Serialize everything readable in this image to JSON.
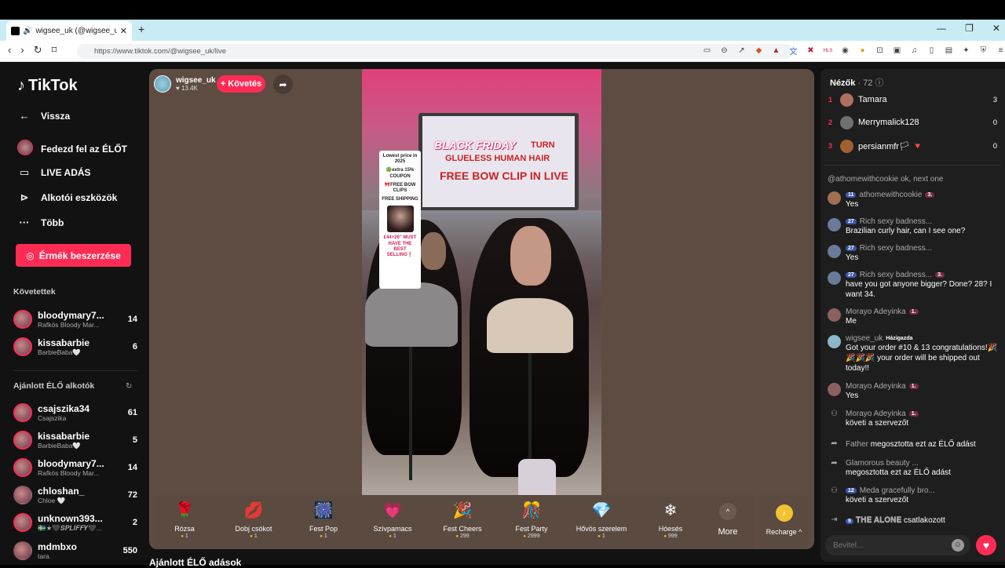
{
  "browser": {
    "tab_title": "wigsee_uk (@wigsee_uk) ÉLŐ",
    "url": "https://www.tiktok.com/@wigsee_uk/live"
  },
  "sidebar": {
    "logo": "TikTok",
    "back": "Vissza",
    "nav": [
      {
        "label": "Fedezd fel az ÉLŐT",
        "icon": "avatar-icon"
      },
      {
        "label": "LIVE ADÁS",
        "icon": "video-camera-icon"
      },
      {
        "label": "Alkotói eszközök",
        "icon": "creator-tools-icon"
      },
      {
        "label": "Több",
        "icon": "more-icon"
      }
    ],
    "coin_button": "Érmék beszerzése",
    "following_title": "Követettek",
    "following": [
      {
        "name": "bloodymary7...",
        "sub": "Rafkós Bloody Mar...",
        "count": "14"
      },
      {
        "name": "kissabarbie",
        "sub": "BarbieBaba🤍",
        "count": "6"
      }
    ],
    "recommended_title": "Ajánlott ÉLŐ alkotók",
    "recommended": [
      {
        "name": "csajszika34",
        "sub": "Csajszika",
        "count": "61"
      },
      {
        "name": "kissabarbie",
        "sub": "BarbieBaba🤍",
        "count": "5"
      },
      {
        "name": "bloodymary7...",
        "sub": "Rafkós Bloody Mar...",
        "count": "14"
      },
      {
        "name": "chloshan_",
        "sub": "Chloe 🤍",
        "count": "72"
      },
      {
        "name": "unknown393...",
        "sub": "🇸🇪★🖤𝑺𝑷𝑳𝑰𝑭𝑭𝒀🖤...",
        "count": "2"
      },
      {
        "name": "mdmbxo",
        "sub": "tara.",
        "count": "550"
      }
    ]
  },
  "host": {
    "name": "wigsee_uk",
    "likes": "13.4K",
    "follow_label": "+ Követés"
  },
  "video_overlay": {
    "black_friday": "BLACK FRIDAY",
    "tv_line1": "TURN",
    "tv_line2": "GLUELESS HUMAN HAIR",
    "tv_line3": "FREE BOW CLIP IN LIVE",
    "price_board": {
      "line1": "Lowest price in 2025",
      "line2": "🟢extra 15% COUPON",
      "line3": "🎀FREE BOW CLIPS",
      "line4": "FREE SHIPPING",
      "line5": "£44+26'' MUST HAVE THE BEST SELLING❗"
    }
  },
  "gifts": [
    {
      "name": "Rózsa",
      "price": "1",
      "icon": "🌹"
    },
    {
      "name": "Dobj csókot",
      "price": "1",
      "icon": "💋"
    },
    {
      "name": "Fest Pop",
      "price": "1",
      "icon": "🎆"
    },
    {
      "name": "Szívpamacs",
      "price": "1",
      "icon": "💗"
    },
    {
      "name": "Fest Cheers",
      "price": "299",
      "icon": "🎉"
    },
    {
      "name": "Fest Party",
      "price": "2999",
      "icon": "🎊"
    },
    {
      "name": "Hővös szerelem",
      "price": "1",
      "icon": "💎"
    },
    {
      "name": "Hóesés",
      "price": "999",
      "icon": "❄"
    }
  ],
  "gift_more": "More",
  "recharge": "Recharge ^",
  "recommended_bottom": "Ajánlott ÉLŐ adások",
  "viewers": {
    "title": "Nézők",
    "count": "· 72",
    "top": [
      {
        "rank": "1",
        "name": "Tamara",
        "score": "3",
        "color": "#b07060"
      },
      {
        "rank": "2",
        "name": "Merrymalick128",
        "score": "0",
        "color": "#707070"
      },
      {
        "rank": "3",
        "name": "persianmfr🏳 🔻",
        "score": "0",
        "color": "#a06030"
      }
    ]
  },
  "chat": [
    {
      "type": "msg",
      "user": "@athomewithcookie ok, next one",
      "text": "",
      "badge": "",
      "fan": "",
      "color": "#8a6a5a"
    },
    {
      "type": "msg",
      "user": "athomewithcookie",
      "text": "Yes",
      "badge": "11",
      "fan": "3.",
      "color": "#a07050"
    },
    {
      "type": "msg",
      "user": "Rich sexy badness...",
      "text": "Brazilian curly hair, can I see one?",
      "badge": "27",
      "fan": "",
      "color": "#6a7a9a"
    },
    {
      "type": "msg",
      "user": "Rich sexy badness...",
      "text": "Yes",
      "badge": "27",
      "fan": "",
      "color": "#6a7a9a"
    },
    {
      "type": "msg",
      "user": "Rich sexy badness...",
      "text": "have you got anyone bigger? Done? 28? I want 34.",
      "badge": "27",
      "fan": "3.",
      "color": "#6a7a9a"
    },
    {
      "type": "msg",
      "user": "Morayo Adeyinka",
      "text": "Me",
      "badge": "",
      "fan": "1.",
      "color": "#8a6060"
    },
    {
      "type": "msg",
      "user": "wigsee_uk",
      "text": "Got your order #10 & 13 congratulations!🎉🎉🎉🎉 your order will be shipped out today!!",
      "badge": "",
      "fan": "",
      "host": "Házigazda",
      "color": "#8ab8c8"
    },
    {
      "type": "msg",
      "user": "Morayo Adeyinka",
      "text": "Yes",
      "badge": "",
      "fan": "1.",
      "color": "#8a6060"
    },
    {
      "type": "msg",
      "user": "Morayo Adeyinka",
      "text": "követi a szervezőt",
      "badge": "",
      "fan": "1.",
      "color": "#8a6060"
    },
    {
      "type": "sys",
      "user": "Father",
      "text": "megosztotta ezt az ÉLŐ adást",
      "icon": "share-icon"
    },
    {
      "type": "sys",
      "user": "Glamorous beauty ...",
      "text": "megosztotta ezt az ÉLŐ adást",
      "icon": "share-icon"
    },
    {
      "type": "sys",
      "user": "Meda gracefully bro...",
      "text": "követi a szervezőt",
      "badge": "12",
      "icon": "follow-icon"
    },
    {
      "type": "sys",
      "user": "𝐓𝐇𝐄 𝐀𝐋𝐎𝐍𝐄",
      "text": "csatlakozott",
      "badge": "9",
      "icon": "join-icon"
    }
  ],
  "chat_input_placeholder": "Bevitel..."
}
